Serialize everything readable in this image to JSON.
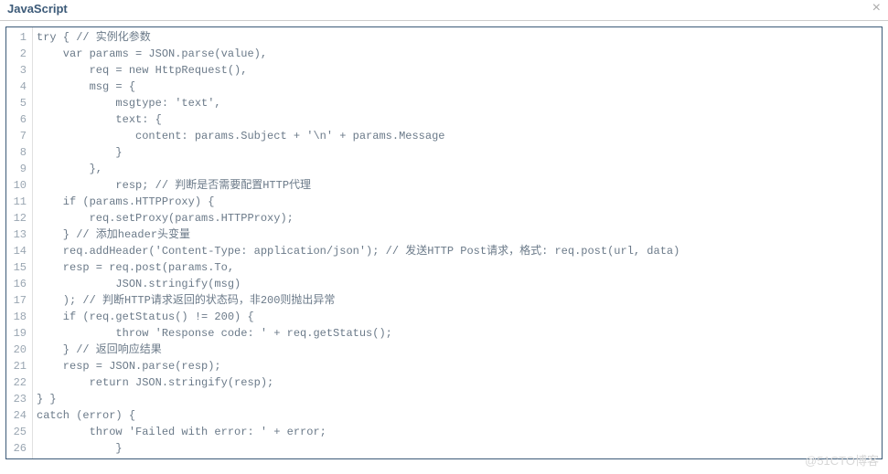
{
  "header": {
    "title": "JavaScript",
    "close_glyph": "×"
  },
  "code": {
    "lines": [
      "try { // 实例化参数",
      "    var params = JSON.parse(value),",
      "        req = new HttpRequest(),",
      "        msg = {",
      "            msgtype: 'text',",
      "            text: {",
      "               content: params.Subject + '\\n' + params.Message",
      "            }",
      "        },",
      "            resp; // 判断是否需要配置HTTP代理",
      "    if (params.HTTPProxy) {",
      "        req.setProxy(params.HTTPProxy);",
      "    } // 添加header头变量",
      "    req.addHeader('Content-Type: application/json'); // 发送HTTP Post请求，格式: req.post(url, data)",
      "    resp = req.post(params.To,",
      "            JSON.stringify(msg)",
      "    ); // 判断HTTP请求返回的状态码，非200则抛出异常",
      "    if (req.getStatus() != 200) {",
      "            throw 'Response code: ' + req.getStatus();",
      "    } // 返回响应结果",
      "    resp = JSON.parse(resp);",
      "        return JSON.stringify(resp);",
      "} }",
      "catch (error) {",
      "        throw 'Failed with error: ' + error;",
      "            }"
    ]
  },
  "watermark": {
    "text": "@51CTO博客"
  }
}
